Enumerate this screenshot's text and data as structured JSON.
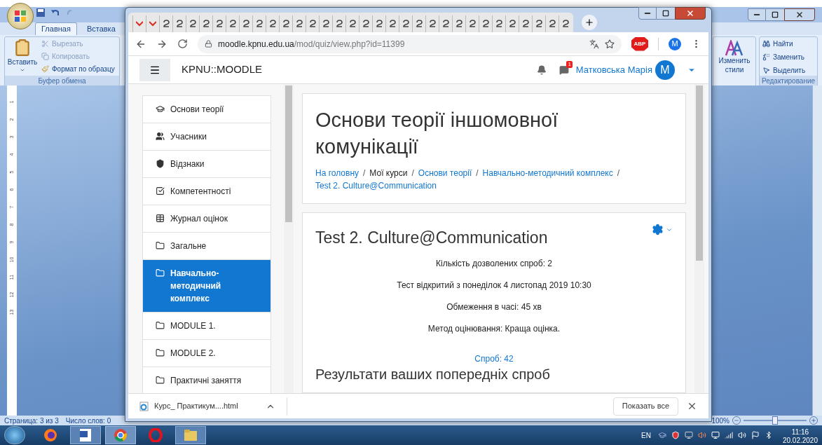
{
  "word": {
    "ribbon_tabs": [
      {
        "label": "Главная",
        "selected": true
      },
      {
        "label": "Вставка",
        "selected": false
      }
    ],
    "clipboard": {
      "paste": "Вставить",
      "cut": "Вырезать",
      "copy": "Копировать",
      "format_painter": "Формат по образцу",
      "group": "Буфер обмена"
    },
    "styles": {
      "change_line1": "Изменить",
      "change_line2": "стили"
    },
    "editing": {
      "find": "Найти",
      "replace": "Заменить",
      "select": "Выделить",
      "group": "Редактирование"
    },
    "ruler_numbers": [
      "1",
      "2",
      "3",
      "4",
      "5",
      "6",
      "7",
      "8",
      "9",
      "10",
      "11",
      "12",
      "13"
    ],
    "status_bar": {
      "page": "Страница: 3 из 3",
      "words": "Число слов: 0",
      "zoom": "100%"
    },
    "zoom_slider": {
      "level": 0.5
    }
  },
  "browser": {
    "url_host": "moodle.kpnu.edu.ua",
    "url_path": "/mod/quiz/view.php?id=11399",
    "adblock": "ABP",
    "profile": "M",
    "site": {
      "brand": "KPNU::MOODLE",
      "message_count": "1",
      "user_name": "Матковська Марія",
      "avatar": "M"
    },
    "sidebar": [
      {
        "label": "Основи теорії",
        "kind": "course",
        "selected": false
      },
      {
        "label": "Учасники",
        "kind": "participants",
        "selected": false
      },
      {
        "label": "Відзнаки",
        "kind": "badges",
        "selected": false
      },
      {
        "label": "Компетентності",
        "kind": "competencies",
        "selected": false
      },
      {
        "label": "Журнал оцінок",
        "kind": "grades",
        "selected": false
      },
      {
        "label": "Загальне",
        "kind": "folder",
        "selected": false
      },
      {
        "label": "Навчально-методичний комплекс",
        "kind": "folder",
        "selected": true
      },
      {
        "label": "MODULE 1.",
        "kind": "folder",
        "selected": false
      },
      {
        "label": "MODULE 2.",
        "kind": "folder",
        "selected": false
      },
      {
        "label": "Практичні заняття",
        "kind": "folder",
        "selected": false
      }
    ],
    "course_title": "Основи теорії іншомовної комунікації",
    "breadcrumb_separator": "/",
    "breadcrumbs": [
      {
        "label": "На головну",
        "link": true
      },
      {
        "label": "Мої курси",
        "link": false
      },
      {
        "label": "Основи теорії",
        "link": true
      },
      {
        "label": "Навчально-методичний комплекс",
        "link": true
      },
      {
        "label": "Test 2. Culture@Communication",
        "link": true
      }
    ],
    "quiz": {
      "title": "Test 2. Culture@Communication",
      "info": [
        "Кількість дозволених спроб: 2",
        "Тест відкритий з понеділок 4 листопад 2019 10:30",
        "Обмеження в часі: 45 хв",
        "Метод оцінювання: Краща оцінка."
      ],
      "attempts_link": "Спроб: 42",
      "results_heading": "Результати ваших попередніх спроб"
    },
    "download": {
      "file": "Курс_ Практикум....html",
      "show_all": "Показать все"
    }
  },
  "taskbar": {
    "language": "EN",
    "time": "11:16",
    "date": "20.02.2020"
  }
}
